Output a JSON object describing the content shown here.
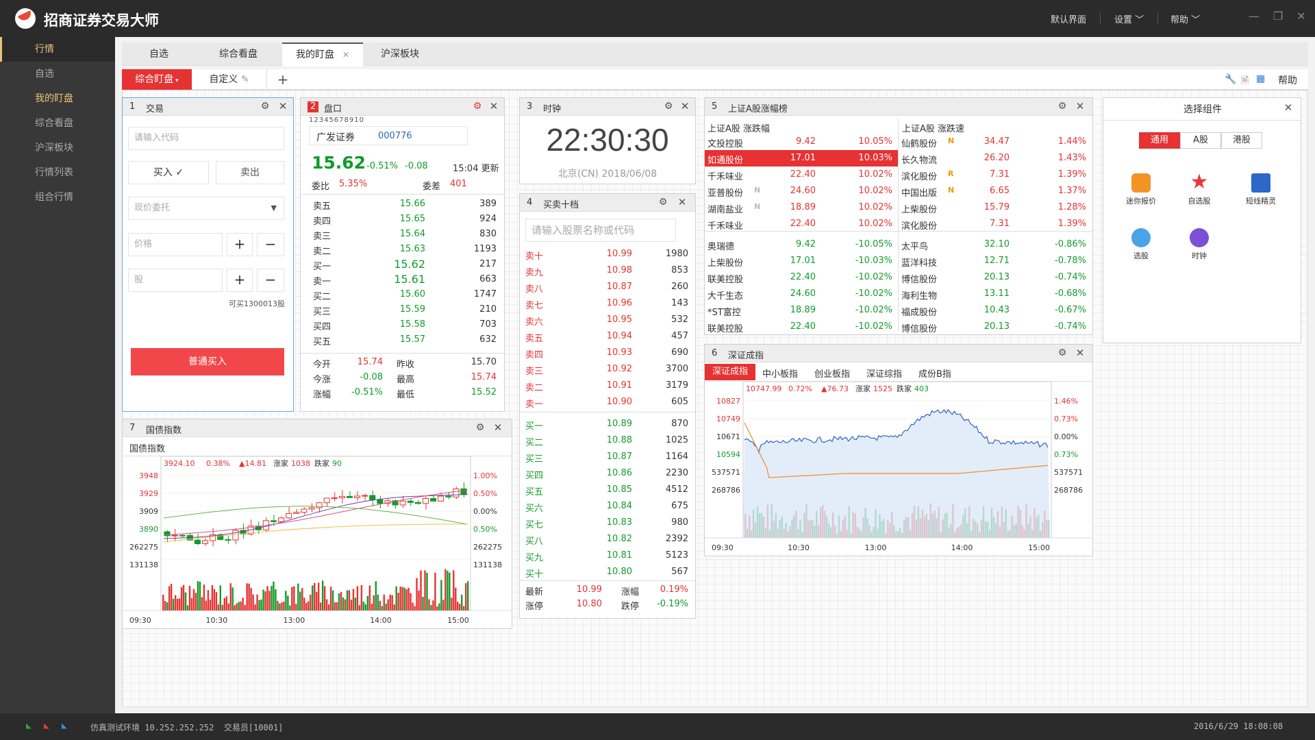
{
  "app": {
    "title": "招商证券交易大师",
    "menu": [
      "默认界面",
      "设置",
      "帮助"
    ]
  },
  "sidebar": {
    "items": [
      "行情",
      "自选",
      "我的盯盘",
      "综合看盘",
      "沪深板块",
      "行情列表",
      "组合行情"
    ]
  },
  "tabs": [
    "自选",
    "综合看盘",
    "我的盯盘",
    "沪深板块"
  ],
  "subtabs": {
    "active": "综合盯盘",
    "custom": "自定义",
    "add": "+",
    "help": "帮助"
  },
  "status": {
    "env": "仿真测试环境 10.252.252.252  交易员[10001]",
    "time": "2016/6/29 18:08:08"
  },
  "trade": {
    "num": "1",
    "title": "交易",
    "code_placeholder": "请输入代码",
    "buy": "买入 ✓",
    "sell": "卖出",
    "order_type": "现价委托",
    "price_ph": "价格",
    "qty_ph": "股",
    "available": "可买1300013股",
    "submit": "普通买入"
  },
  "quote": {
    "num": "2",
    "title": "盘口",
    "pages": "12345678910",
    "name": "广发证券",
    "code": "000776",
    "price": "15.62",
    "pct": "-0.51%",
    "chg": "-0.08",
    "time": "15:04 更新",
    "wb_label": "委比",
    "wb": "5.35%",
    "wc_label": "委差",
    "wc": "401",
    "asks": [
      [
        "卖五",
        "15.66",
        "389"
      ],
      [
        "卖四",
        "15.65",
        "924"
      ],
      [
        "卖三",
        "15.64",
        "830"
      ],
      [
        "卖二",
        "15.63",
        "1193"
      ],
      [
        "买一",
        "15.62",
        "217"
      ]
    ],
    "bids": [
      [
        "卖一",
        "15.61",
        "663"
      ],
      [
        "买二",
        "15.60",
        "1747"
      ],
      [
        "买三",
        "15.59",
        "210"
      ],
      [
        "买四",
        "15.58",
        "703"
      ],
      [
        "买五",
        "15.57",
        "632"
      ]
    ],
    "stats": [
      [
        "今开",
        "15.74",
        "昨收",
        "15.70"
      ],
      [
        "今涨",
        "-0.08",
        "最高",
        "15.74"
      ],
      [
        "涨幅",
        "-0.51%",
        "最低",
        "15.52"
      ]
    ]
  },
  "clock": {
    "num": "3",
    "title": "时钟",
    "time": "22:30:30",
    "date": "北京(CN) 2018/06/08"
  },
  "ten": {
    "num": "4",
    "title": "买卖十档",
    "placeholder": "请输入股票名称或代码",
    "sells": [
      [
        "卖十",
        "10.99",
        "1980"
      ],
      [
        "卖九",
        "10.98",
        "853"
      ],
      [
        "卖八",
        "10.87",
        "260"
      ],
      [
        "卖七",
        "10.96",
        "143"
      ],
      [
        "卖六",
        "10.95",
        "532"
      ],
      [
        "卖五",
        "10.94",
        "457"
      ],
      [
        "卖四",
        "10.93",
        "690"
      ],
      [
        "卖三",
        "10.92",
        "3700"
      ],
      [
        "卖二",
        "10.91",
        "3179"
      ],
      [
        "卖一",
        "10.90",
        "605"
      ]
    ],
    "buys": [
      [
        "买一",
        "10.89",
        "870"
      ],
      [
        "买二",
        "10.88",
        "1025"
      ],
      [
        "买三",
        "10.87",
        "1164"
      ],
      [
        "买四",
        "10.86",
        "2230"
      ],
      [
        "买五",
        "10.85",
        "4512"
      ],
      [
        "买六",
        "10.84",
        "675"
      ],
      [
        "买七",
        "10.83",
        "980"
      ],
      [
        "买八",
        "10.82",
        "2392"
      ],
      [
        "买九",
        "10.81",
        "5123"
      ],
      [
        "买十",
        "10.80",
        "567"
      ]
    ],
    "foot": [
      [
        "最新",
        "10.99",
        "涨幅",
        "0.19%"
      ],
      [
        "涨停",
        "10.80",
        "跌停",
        "-0.19%"
      ]
    ]
  },
  "rank": {
    "num": "5",
    "title": "上证A股涨幅榜",
    "left_title": "上证A股 涨跌幅",
    "right_title": "上证A股 涨跌速",
    "left": [
      [
        "文投控股",
        "",
        "9.42",
        "10.05%"
      ],
      [
        "如通股份",
        "",
        "17.01",
        "10.03%"
      ],
      [
        "千禾味业",
        "",
        "22.40",
        "10.02%"
      ],
      [
        "亚普股份",
        "N",
        "24.60",
        "10.02%"
      ],
      [
        "湖南盐业",
        "N",
        "18.89",
        "10.02%"
      ],
      [
        "千禾味业",
        "",
        "22.40",
        "10.02%"
      ],
      [
        "奥瑞德",
        "",
        "9.42",
        "-10.05%"
      ],
      [
        "上柴股份",
        "",
        "17.01",
        "-10.03%"
      ],
      [
        "联美控股",
        "",
        "22.40",
        "-10.02%"
      ],
      [
        "大千生态",
        "",
        "24.60",
        "-10.02%"
      ],
      [
        "*ST富控",
        "",
        "18.89",
        "-10.02%"
      ],
      [
        "联美控股",
        "",
        "22.40",
        "-10.02%"
      ]
    ],
    "right": [
      [
        "仙鹤股份",
        "N",
        "34.47",
        "1.44%"
      ],
      [
        "长久物流",
        "",
        "26.20",
        "1.43%"
      ],
      [
        "滨化股份",
        "R",
        "7.31",
        "1.39%"
      ],
      [
        "中国出版",
        "N",
        "6.65",
        "1.37%"
      ],
      [
        "上柴股份",
        "",
        "15.79",
        "1.28%"
      ],
      [
        "滨化股份",
        "",
        "7.31",
        "1.39%"
      ],
      [
        "太平鸟",
        "",
        "32.10",
        "-0.86%"
      ],
      [
        "蓝洋科技",
        "",
        "12.71",
        "-0.78%"
      ],
      [
        "博信股份",
        "",
        "20.13",
        "-0.74%"
      ],
      [
        "海利生物",
        "",
        "13.11",
        "-0.68%"
      ],
      [
        "福成股份",
        "",
        "10.43",
        "-0.67%"
      ],
      [
        "博信股份",
        "",
        "20.13",
        "-0.74%"
      ]
    ]
  },
  "widgets": {
    "title": "选择组件",
    "tabs": [
      "通用",
      "A股",
      "港股"
    ],
    "items": [
      "迷你报价",
      "自选股",
      "短线精灵",
      "选股",
      "时钟"
    ]
  },
  "sz": {
    "num": "6",
    "title": "深证成指",
    "tabs": [
      "深证成指",
      "中小板指",
      "创业板指",
      "深证综指",
      "成份B指"
    ],
    "last": "10747.99",
    "pct": "0.72%",
    "chg": "▲76.73",
    "up_l": "涨家",
    "up": "1525",
    "down_l": "跌家",
    "down": "403",
    "yl": [
      "10827",
      "10749",
      "10671",
      "10594",
      "537571",
      "268786"
    ],
    "yr": [
      "1.46%",
      "0.73%",
      "0.00%",
      "0.73%",
      "537571",
      "268786"
    ],
    "xt": [
      "09:30",
      "10:30",
      "13:00",
      "14:00",
      "15:00"
    ]
  },
  "gz": {
    "num": "7",
    "title": "国债指数",
    "label": "国债指数",
    "last": "3924.10",
    "pct": "0.38%",
    "chg": "▲14.81",
    "up_l": "涨家",
    "up": "1038",
    "down_l": "跌家",
    "down": "90",
    "yl": [
      "3948",
      "3929",
      "3909",
      "3890",
      "262275",
      "131138"
    ],
    "yr": [
      "1.00%",
      "0.50%",
      "0.00%",
      "0.50%",
      "262275",
      "131138"
    ],
    "xt": [
      "09:30",
      "10:30",
      "13:00",
      "14:00",
      "15:00"
    ]
  },
  "colors": {
    "up": "#e63232",
    "down": "#119b2a",
    "accent": "#e8c27a"
  }
}
